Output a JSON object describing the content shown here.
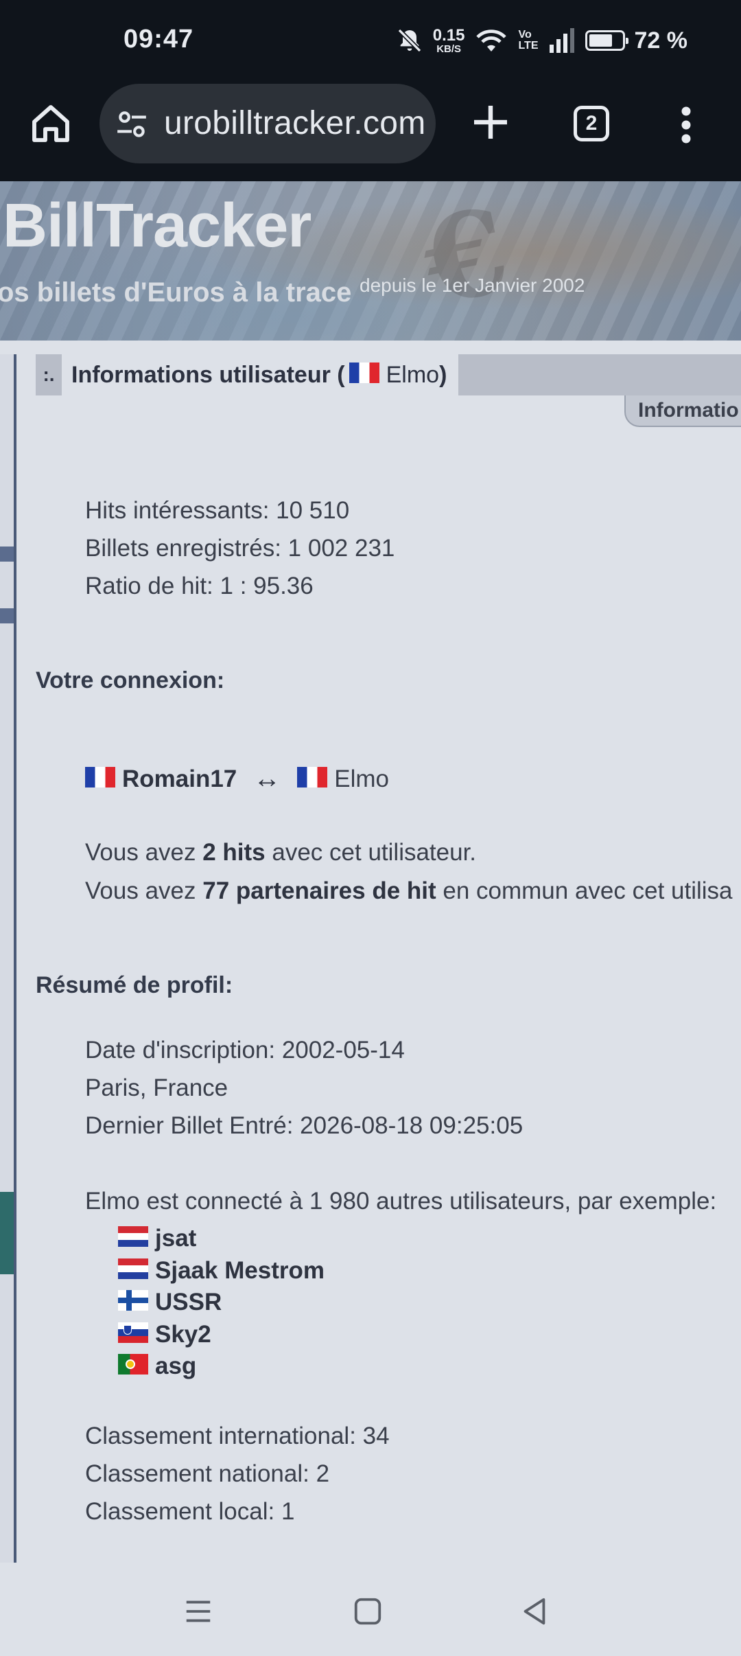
{
  "status_bar": {
    "time": "09:47",
    "net_speed_value": "0.15",
    "net_speed_unit": "KB/S",
    "volte_top": "Vo",
    "volte_bottom": "LTE",
    "battery_text": "72 %",
    "battery_level_percent": 72,
    "icons": [
      "bell-off-icon",
      "wifi-icon",
      "signal-icon",
      "battery-icon"
    ]
  },
  "browser": {
    "url_text": "urobilltracker.com",
    "tab_count": "2",
    "icons": [
      "home-icon",
      "site-settings-icon",
      "new-tab-icon",
      "tabs-icon",
      "overflow-menu-icon"
    ]
  },
  "site_header": {
    "title": "BillTracker",
    "tagline": "os billets d'Euros à la trace",
    "since": "depuis le 1er Janvier 2002"
  },
  "panel": {
    "marker": ":.",
    "title_prefix": "Informations utilisateur (",
    "username": "Elmo",
    "title_suffix": ")",
    "tab_label": "Informatio"
  },
  "stats": {
    "hits_interessants": "Hits intéressants: 10 510",
    "billets": "Billets enregistrés: 1 002 231",
    "ratio": "Ratio de hit: 1 : 95.36"
  },
  "connexion": {
    "heading": "Votre connexion:",
    "from_user": "Romain17",
    "arrow": "↔",
    "to_user": "Elmo",
    "hits_line_pre": "Vous avez ",
    "hits_line_bold": "2 hits",
    "hits_line_post": " avec cet utilisateur.",
    "partners_pre": "Vous avez ",
    "partners_bold": "77 partenaires de hit",
    "partners_post": " en commun avec cet utilisa"
  },
  "profil": {
    "heading": "Résumé de profil:",
    "date_inscription": "Date d'inscription: 2002-05-14",
    "location": "Paris, France",
    "dernier_billet": "Dernier Billet Entré: 2026-08-18 09:25:05",
    "connected_text": "Elmo est connecté à 1 980 autres utilisateurs, par exemple:",
    "connected_users": [
      {
        "name": "jsat",
        "flag": "nl"
      },
      {
        "name": "Sjaak Mestrom",
        "flag": "nl"
      },
      {
        "name": "USSR",
        "flag": "fi"
      },
      {
        "name": "Sky2",
        "flag": "si"
      },
      {
        "name": "asg",
        "flag": "pt"
      }
    ],
    "classement_international": "Classement international: 34",
    "classement_national": "Classement national: 2",
    "classement_local": "Classement local: 1"
  },
  "nav_bar": {
    "icons": [
      "recents-icon",
      "home-button-icon",
      "back-icon"
    ]
  }
}
